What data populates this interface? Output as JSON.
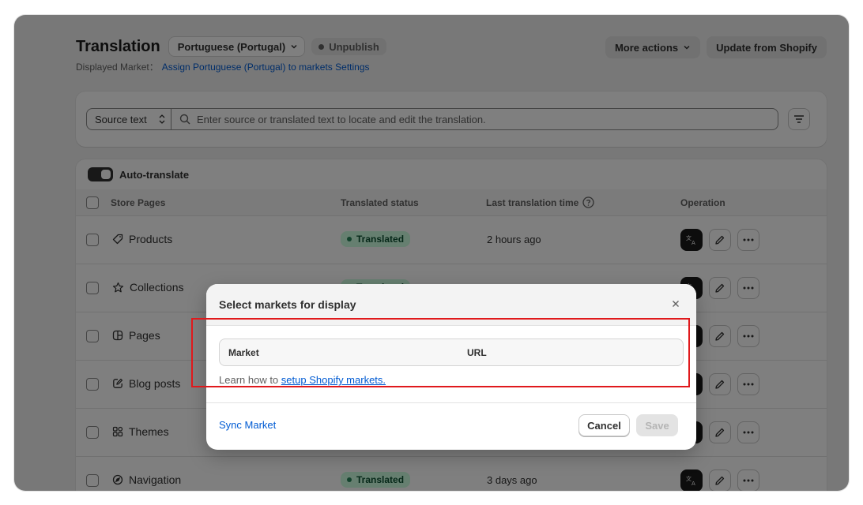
{
  "header": {
    "title": "Translation",
    "language": "Portuguese (Portugal)",
    "status": "Unpublish",
    "displayed_market_label": "Displayed Market：",
    "displayed_market_link": "Assign Portuguese (Portugal) to markets Settings",
    "more_actions": "More actions",
    "update_button": "Update from Shopify"
  },
  "search": {
    "source_select": "Source text",
    "placeholder": "Enter source or translated text to locate and edit the translation."
  },
  "table": {
    "auto_translate": "Auto-translate",
    "columns": [
      "Store Pages",
      "Translated status",
      "Last translation time",
      "Operation"
    ],
    "rows": [
      {
        "name": "Products",
        "icon": "tag-icon",
        "status": "Translated",
        "time": "2 hours ago"
      },
      {
        "name": "Collections",
        "icon": "star-icon",
        "status": "",
        "time": ""
      },
      {
        "name": "Pages",
        "icon": "pages-icon",
        "status": "",
        "time": ""
      },
      {
        "name": "Blog posts",
        "icon": "edit-square-icon",
        "status": "",
        "time": ""
      },
      {
        "name": "Themes",
        "icon": "apps-icon",
        "status": "",
        "time": ""
      },
      {
        "name": "Navigation",
        "icon": "compass-icon",
        "status": "Translated",
        "time": "3 days ago"
      }
    ]
  },
  "modal": {
    "title": "Select markets for display",
    "col_market": "Market",
    "col_url": "URL",
    "learn_prefix": "Learn how to",
    "learn_link": "setup Shopify markets.",
    "sync": "Sync Market",
    "cancel": "Cancel",
    "save": "Save"
  },
  "colors": {
    "link": "#005bd3",
    "highlight": "#e0191c",
    "badge_bg": "#cdfee1"
  }
}
